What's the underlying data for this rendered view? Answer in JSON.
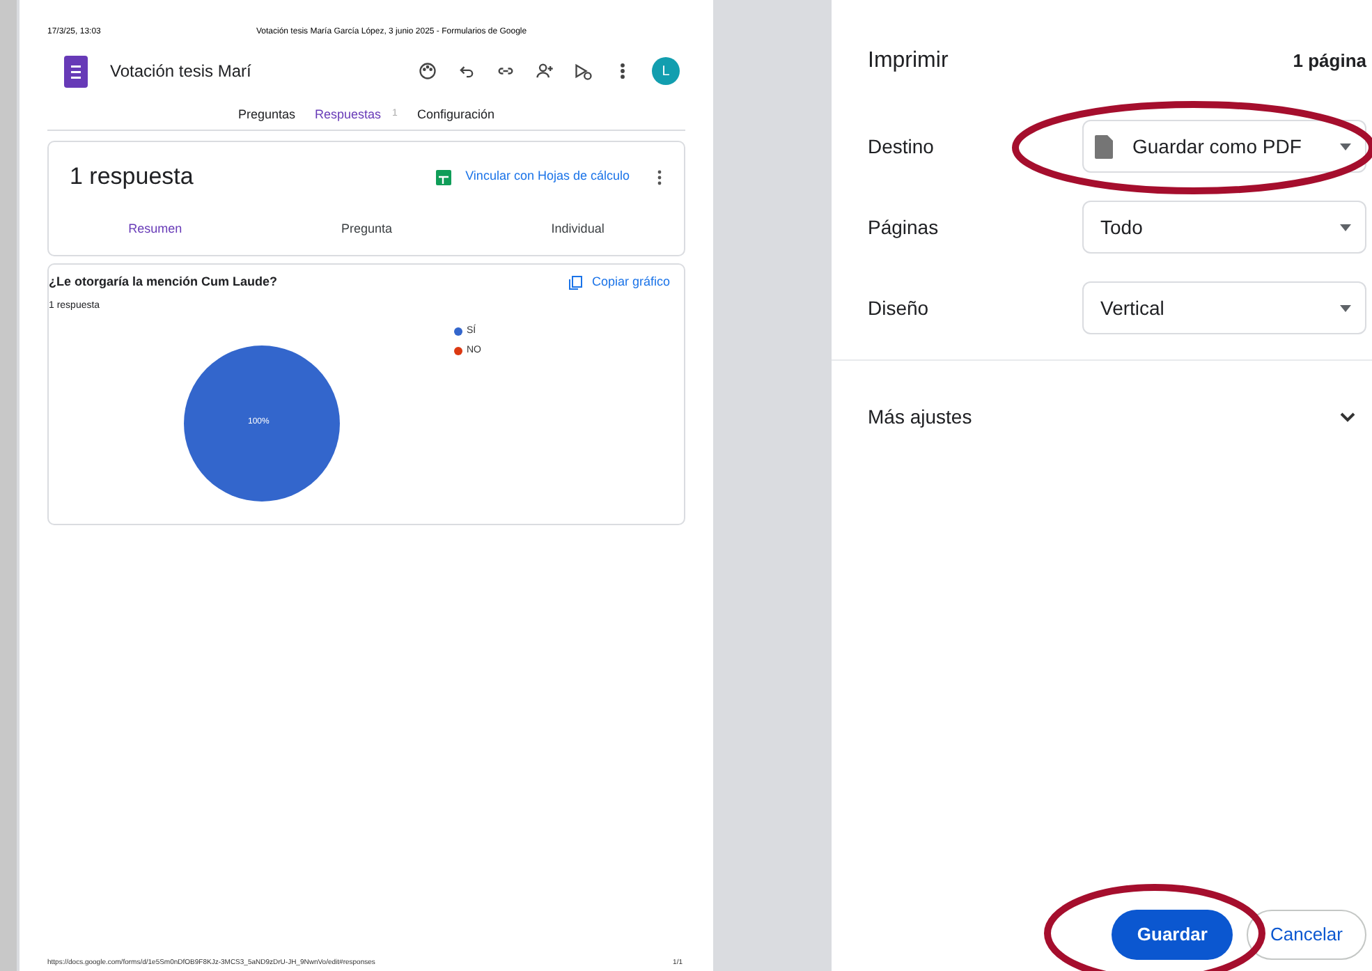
{
  "preview": {
    "header_left": "17/3/25, 13:03",
    "header_center": "Votación tesis María García López, 3 junio 2025 - Formularios de Google",
    "form_title": "Votación tesis Marí",
    "avatar": "L",
    "tabs": [
      {
        "label": "Preguntas",
        "selected": false
      },
      {
        "label": "Respuestas",
        "selected": true,
        "count": "1"
      },
      {
        "label": "Configuración",
        "selected": false
      }
    ],
    "responses_title": "1 respuesta",
    "link_sheets": "Vincular con Hojas de cálculo",
    "subtabs": [
      {
        "label": "Resumen",
        "selected": true
      },
      {
        "label": "Pregunta",
        "selected": false
      },
      {
        "label": "Individual",
        "selected": false
      }
    ],
    "question": {
      "title": "¿Le otorgaría la mención Cum Laude?",
      "copy": "Copiar gráfico",
      "count": "1 respuesta",
      "chart_data": {
        "type": "pie",
        "categories": [
          "SÍ",
          "NO"
        ],
        "values": [
          100,
          0
        ],
        "colors": [
          "#3366cc",
          "#dc3912"
        ],
        "value_labels": [
          "100%",
          null
        ]
      }
    },
    "footer_url": "https://docs.google.com/forms/d/1e5Sm0nDfOB9F8KJz-3MCS3_5aND9zDrU-JH_9NwnVo/edit#responses",
    "footer_page": "1/1"
  },
  "print": {
    "title": "Imprimir",
    "pages_count": "1 página",
    "settings": [
      {
        "label": "Destino",
        "value": "Guardar como PDF",
        "kind": "file"
      },
      {
        "label": "Páginas",
        "value": "Todo",
        "kind": "plain"
      },
      {
        "label": "Diseño",
        "value": "Vertical",
        "kind": "plain"
      }
    ],
    "more": "Más ajustes",
    "buttons": [
      {
        "label": "Guardar",
        "kind": "primary"
      },
      {
        "label": "Cancelar",
        "kind": "secondary"
      }
    ]
  }
}
